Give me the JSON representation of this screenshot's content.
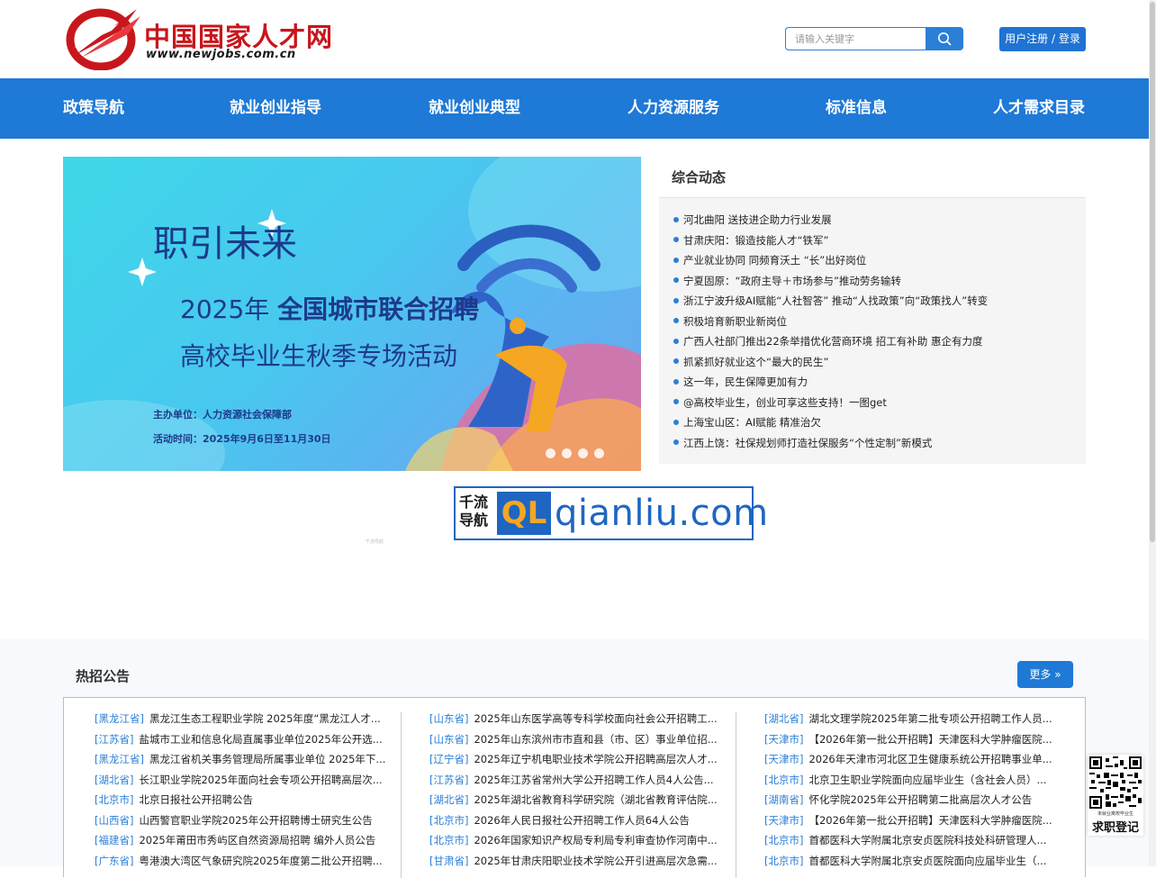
{
  "header": {
    "logo_cn": "中国国家人才网",
    "logo_en": "www.newjobs.com.cn",
    "search_placeholder": "请输入关键字",
    "login_label": "用户注册 / 登录"
  },
  "nav": [
    {
      "label": "政策导航"
    },
    {
      "label": "就业创业指导"
    },
    {
      "label": "就业创业典型"
    },
    {
      "label": "人力资源服务"
    },
    {
      "label": "标准信息"
    },
    {
      "label": "人才需求目录"
    }
  ],
  "banner": {
    "title1": "职引未来",
    "title2_year": "2025年",
    "title2_main": "全国城市联合招聘",
    "title3": "高校毕业生秋季专场活动",
    "organizer": "主办单位：人力资源社会保障部",
    "time": "活动时间：2025年9月6日至11月30日",
    "slide_count": 4
  },
  "news": {
    "title": "综合动态",
    "items": [
      "河北曲阳 送技进企助力行业发展",
      "甘肃庆阳：锻造技能人才“铁军”",
      "产业就业协同 同频育沃土 “长”出好岗位",
      "宁夏固原：“政府主导＋市场参与”推动劳务输转",
      "浙江宁波升级AI赋能“人社智答” 推动“人找政策”向“政策找人”转变",
      "积极培育新职业新岗位",
      "广西人社部门推出22条举措优化营商环境 招工有补助 惠企有力度",
      "抓紧抓好就业这个“最大的民生”",
      "这一年，民生保障更加有力",
      "@高校毕业生，创业可享这些支持！一图get",
      "上海宝山区：AI赋能 精准治欠",
      "江西上饶：社保规划师打造社保服务“个性定制”新模式"
    ]
  },
  "ad": {
    "cn_line1": "千流",
    "cn_line2": "导航",
    "ql": "QL",
    "domain": "qianliu.com",
    "small_text": "千流导航"
  },
  "hot": {
    "title": "热招公告",
    "more_label": "更多 »",
    "columns": [
      [
        {
          "prov": "[黑龙江省]",
          "text": "黑龙江生态工程职业学院 2025年度“黑龙江人才..."
        },
        {
          "prov": "[江苏省]",
          "text": "盐城市工业和信息化局直属事业单位2025年公开选..."
        },
        {
          "prov": "[黑龙江省]",
          "text": "黑龙江省机关事务管理局所属事业单位 2025年下..."
        },
        {
          "prov": "[湖北省]",
          "text": "长江职业学院2025年面向社会专项公开招聘高层次..."
        },
        {
          "prov": "[北京市]",
          "text": "北京日报社公开招聘公告"
        },
        {
          "prov": "[山西省]",
          "text": "山西警官职业学院2025年公开招聘博士研究生公告"
        },
        {
          "prov": "[福建省]",
          "text": "2025年莆田市秀屿区自然资源局招聘 编外人员公告"
        },
        {
          "prov": "[广东省]",
          "text": "粤港澳大湾区气象研究院2025年度第二批公开招聘..."
        }
      ],
      [
        {
          "prov": "[山东省]",
          "text": "2025年山东医学高等专科学校面向社会公开招聘工..."
        },
        {
          "prov": "[山东省]",
          "text": "2025年山东滨州市市直和县（市、区）事业单位招..."
        },
        {
          "prov": "[辽宁省]",
          "text": "2025年辽宁机电职业技术学院公开招聘高层次人才..."
        },
        {
          "prov": "[江苏省]",
          "text": "2025年江苏省常州大学公开招聘工作人员4人公告..."
        },
        {
          "prov": "[湖北省]",
          "text": "2025年湖北省教育科学研究院（湖北省教育评估院..."
        },
        {
          "prov": "[北京市]",
          "text": "2026年人民日报社公开招聘工作人员64人公告"
        },
        {
          "prov": "[北京市]",
          "text": "2026年国家知识产权局专利局专利审查协作河南中..."
        },
        {
          "prov": "[甘肃省]",
          "text": "2025年甘肃庆阳职业技术学院公开引进高层次急需..."
        }
      ],
      [
        {
          "prov": "[湖北省]",
          "text": "湖北文理学院2025年第二批专项公开招聘工作人员..."
        },
        {
          "prov": "[天津市]",
          "text": "【2026年第一批公开招聘】天津医科大学肿瘤医院..."
        },
        {
          "prov": "[天津市]",
          "text": "2026年天津市河北区卫生健康系统公开招聘事业单..."
        },
        {
          "prov": "[北京市]",
          "text": "北京卫生职业学院面向应届毕业生（含社会人员）..."
        },
        {
          "prov": "[湖南省]",
          "text": "怀化学院2025年公开招聘第二批高层次人才公告"
        },
        {
          "prov": "[天津市]",
          "text": "【2026年第一批公开招聘】天津医科大学肿瘤医院..."
        },
        {
          "prov": "[北京市]",
          "text": "首都医科大学附属北京安贞医院科技处科研管理人..."
        },
        {
          "prov": "[北京市]",
          "text": "首都医科大学附属北京安贞医院面向应届毕业生（..."
        }
      ]
    ]
  },
  "qr": {
    "small_text": "未就业离校毕业生",
    "label": "求职登记"
  },
  "colors": {
    "brand_blue": "#1f79d6",
    "logo_red": "#c8161d",
    "link_blue": "#2b7fd6"
  }
}
